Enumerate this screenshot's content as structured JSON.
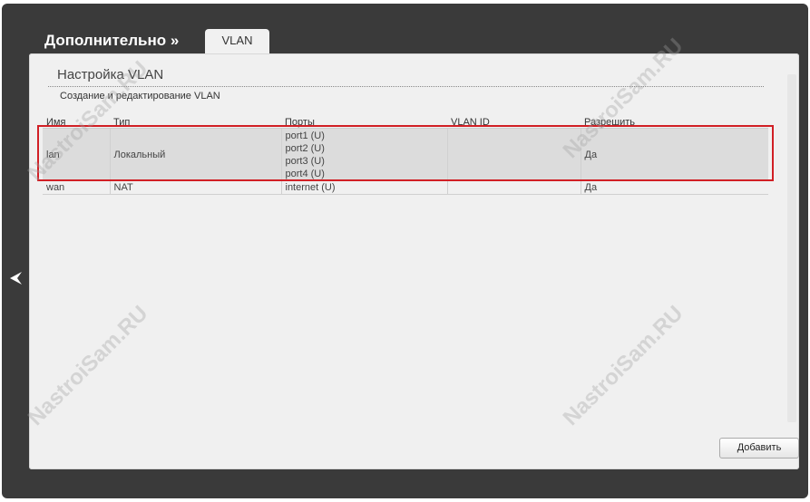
{
  "header": {
    "section_title": "Дополнительно »",
    "tab_label": "VLAN"
  },
  "panel": {
    "title": "Настройка VLAN",
    "subtitle": "Создание и редактирование VLAN"
  },
  "table": {
    "columns": [
      "Имя",
      "Тип",
      "Порты",
      "VLAN ID",
      "Разрешить"
    ],
    "rows": [
      {
        "name": "lan",
        "type": "Локальный",
        "ports": [
          "port1 (U)",
          "port2 (U)",
          "port3 (U)",
          "port4 (U)"
        ],
        "vlan_id": "",
        "enabled": "Да"
      },
      {
        "name": "wan",
        "type": "NAT",
        "ports": [
          "internet (U)"
        ],
        "vlan_id": "",
        "enabled": "Да"
      }
    ]
  },
  "actions": {
    "add_label": "Добавить"
  },
  "watermark": "NastroiSam.RU",
  "colors": {
    "frame_bg": "#3a3a3a",
    "panel_bg": "#f0f0f0",
    "highlight_border": "#d11f25"
  }
}
